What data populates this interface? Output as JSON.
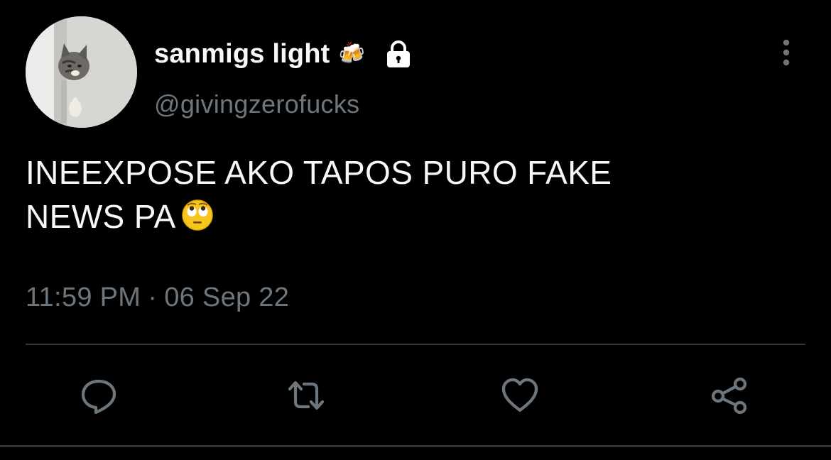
{
  "user": {
    "display_name": "sanmigs light",
    "display_name_emoji": "🍻",
    "username": "@givingzerofucks",
    "avatar_description_icon": "cat-avatar",
    "lock_icon": "lock-icon"
  },
  "tweet": {
    "text_line1": "INEEXPOSE AKO TAPOS PURO FAKE",
    "text_line2": "NEWS PA",
    "text_emoji": "face-with-rolling-eyes",
    "time": "11:59 PM",
    "separator": "·",
    "date": "06 Sep 22"
  },
  "actions": {
    "reply_icon": "reply-icon",
    "retweet_icon": "retweet-icon",
    "like_icon": "heart-icon",
    "share_icon": "share-icon"
  },
  "colors": {
    "background": "#000000",
    "primary_text": "#f5f8fa",
    "secondary_text": "#6e767d",
    "divider": "#2f3336"
  }
}
